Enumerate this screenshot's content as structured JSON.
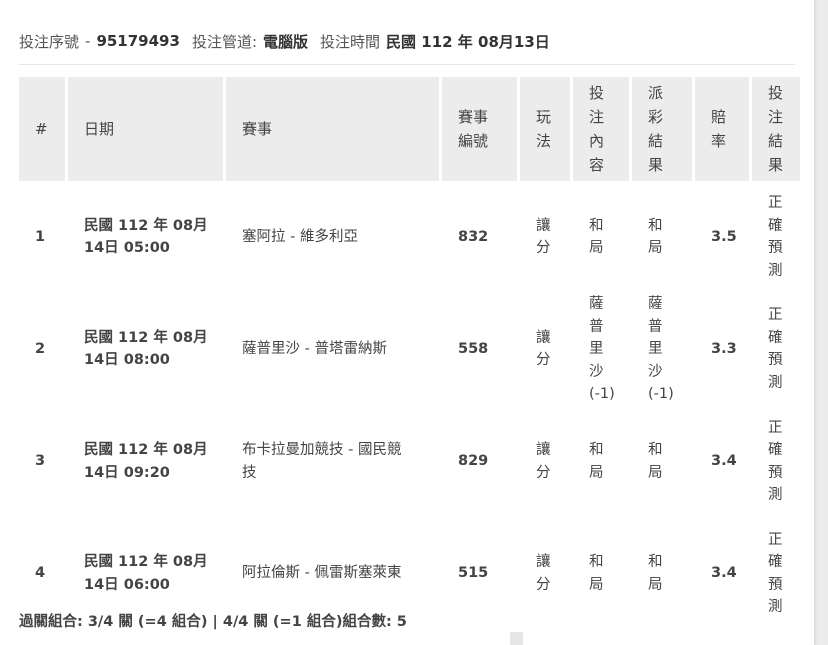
{
  "header": {
    "serial_label": "投注序號",
    "sep": "-",
    "serial_value": "95179493",
    "channel_label": "投注管道:",
    "channel_value": "電腦版",
    "time_label": "投注時間",
    "time_value": "民國 112 年 08月13日"
  },
  "table": {
    "columns": [
      "#",
      "日期",
      "賽事",
      "賽事\n編號",
      "玩\n法",
      "投\n注\n內\n容",
      "派\n彩\n結\n果",
      "賠\n率",
      "投\n注\n結\n果"
    ],
    "rows": [
      {
        "no": "1",
        "date": "民國 112 年 08月\n14日 05:00",
        "match": "塞阿拉 - 維多利亞",
        "match_id": "832",
        "play": "讓\n分",
        "bet": "和\n局",
        "payout": "和\n局",
        "odds": "3.5",
        "result": "正\n確\n預\n測"
      },
      {
        "no": "2",
        "date": "民國 112 年 08月\n14日 08:00",
        "match": "薩普里沙 - 普塔雷納斯",
        "match_id": "558",
        "play": "讓\n分",
        "bet": "薩\n普\n里\n沙\n(-1)",
        "payout": "薩\n普\n里\n沙\n(-1)",
        "odds": "3.3",
        "result": "正\n確\n預\n測"
      },
      {
        "no": "3",
        "date": "民國 112 年 08月\n14日 09:20",
        "match": "布卡拉曼加競技 - 國民競\n技",
        "match_id": "829",
        "play": "讓\n分",
        "bet": "和\n局",
        "payout": "和\n局",
        "odds": "3.4",
        "result": "正\n確\n預\n測"
      },
      {
        "no": "4",
        "date": "民國 112 年 08月\n14日 06:00",
        "match": "阿拉倫斯 - 佩雷斯塞萊東",
        "match_id": "515",
        "play": "讓\n分",
        "bet": "和\n局",
        "payout": "和\n局",
        "odds": "3.4",
        "result": "正\n確\n預\n測"
      }
    ]
  },
  "footer": {
    "summary": "過關組合: 3/4 關 (=4 組合) | 4/4 關 (=1 組合)組合數: 5"
  }
}
